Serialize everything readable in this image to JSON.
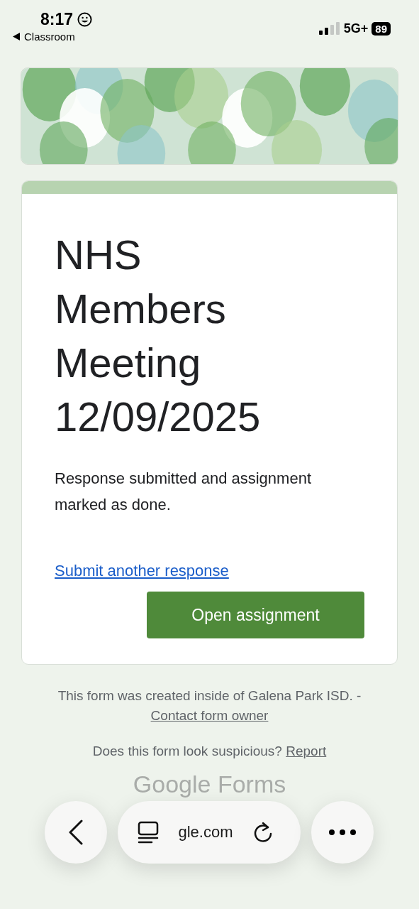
{
  "status_bar": {
    "time": "8:17",
    "back_app": "Classroom",
    "network": "5G+",
    "battery": "89"
  },
  "form": {
    "title": "NHS Members Meeting 12/09/2025",
    "message": "Response submitted and assignment marked as done.",
    "link": "Submit another response",
    "button": "Open assignment"
  },
  "footer": {
    "created": "This form was created inside of Galena Park ISD. -",
    "contact_link": "Contact form owner",
    "suspicious": "Does this form look suspicious?",
    "report_link": "Report",
    "brand": "Google Forms"
  },
  "browser_bar": {
    "url": "gle.com"
  }
}
